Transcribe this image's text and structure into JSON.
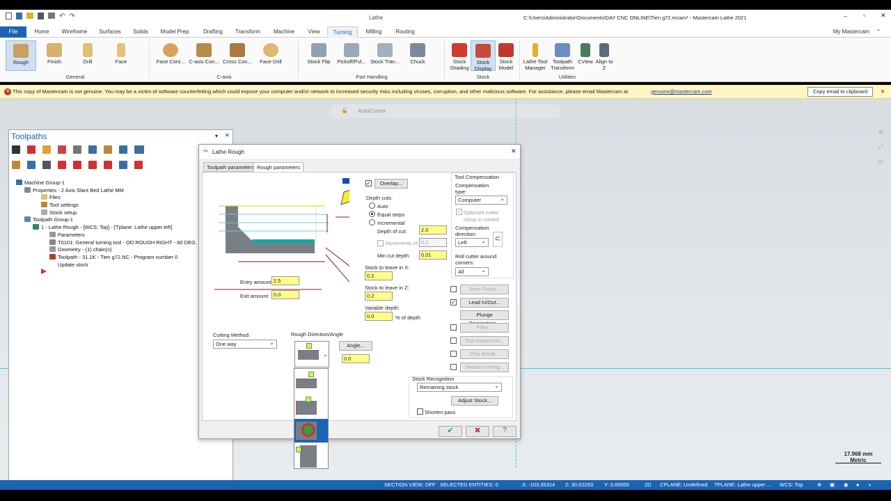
{
  "window": {
    "app_label": "Lathe",
    "title": "C:\\Users\\Administrator\\Documents\\DAY CNC ONLINE\\Tien g72.mcam* - Mastercam Lathe 2021"
  },
  "tabs": [
    "File",
    "Home",
    "Wireframe",
    "Surfaces",
    "Solids",
    "Model Prep",
    "Drafting",
    "Transform",
    "Machine",
    "View",
    "Turning",
    "Milling",
    "Routing"
  ],
  "my_mastercam": "My Mastercam",
  "ribbon": {
    "general": {
      "label": "General",
      "buttons": [
        "Rough",
        "Finish",
        "Drill",
        "Face"
      ]
    },
    "caxis": {
      "label": "C-axis",
      "buttons": [
        "Face Cont...",
        "C-axis Con...",
        "Cross Con...",
        "Face Drill"
      ]
    },
    "part": {
      "label": "Part Handling",
      "buttons": [
        "Stock Flip",
        "Pickoff/Pul...",
        "Stock Tran...",
        "Chuck"
      ]
    },
    "stock": {
      "label": "Stock",
      "buttons": [
        "Stock Shading",
        "Stock Display",
        "Stock Model"
      ]
    },
    "utilities": {
      "label": "Utilities",
      "buttons": [
        "Lathe Tool Manager",
        "Toolpath Transform",
        "CView",
        "Align to Z"
      ]
    }
  },
  "warning": {
    "text": "This copy of Mastercam is not genuine.  You may be a victim of software counterfeiting which could expose your computer and/or network to increased security risks including viruses, corruption, and other malicious software. For assistance, please email Mastercam at",
    "email": "genuine@mastercam.com",
    "copy_button": "Copy email to clipboard"
  },
  "autocursor": "AutoCursor",
  "toolpaths": {
    "title": "Toolpaths",
    "tree": [
      "Machine Group-1",
      "Properties - 2 Axis Slant Bed Lathe MM",
      "Files",
      "Tool settings",
      "Stock setup",
      "Toolpath Group-1",
      "1 - Lathe Rough - [WCS: Top] - [Tplane: Lathe upper left]",
      "Parameters",
      "T0101: General turning tool - OD ROUGH RIGHT - 80 DEG.",
      "Geometry - (1) chain(s)",
      "Toolpath - 31.1K - Tien g72.NC - Program number 0",
      "Update stock"
    ]
  },
  "dialog": {
    "title": "Lathe Rough",
    "tabs": [
      "Toolpath parameters",
      "Rough parameters"
    ],
    "overlap": "Overlap...",
    "depth_cuts": "Depth cuts:",
    "auto": "Auto",
    "equal_steps": "Equal steps",
    "incremental": "Incremental",
    "depth_of_cut_label": "Depth of cut:",
    "depth_of_cut": "2.0",
    "increments_label": "Increments of:",
    "increments": "0.1",
    "min_cut_label": "Min cut depth:",
    "min_cut": "0.01",
    "stock_x_label": "Stock to leave in X:",
    "stock_x": "0.2",
    "stock_z_label": "Stock to leave in Z:",
    "stock_z": "0.2",
    "variable_label": "Variable depth:",
    "variable": "0.0",
    "pct_depth": "% of depth",
    "entry_label": "Entry amount:",
    "entry": "2.5",
    "exit_label": "Exit amount:",
    "exit": "0.0",
    "cutting_method_label": "Cutting Method:",
    "cutting_method": "One way",
    "rough_dir_label": "Rough Direction/Angle",
    "angle_button": "Angle...",
    "angle": "0.0",
    "tool_comp": "Tool Compensation",
    "comp_type_label": "Compensation type:",
    "comp_type": "Computer",
    "optimize": "Optimize cutter comp in control",
    "comp_dir_label": "Compensation direction:",
    "comp_dir": "Left",
    "roll_label": "Roll cutter around corners:",
    "roll": "All",
    "semi_finish": "Semi Finish...",
    "lead": "Lead In/Out...",
    "plunge": "Plunge Parameters...",
    "filter": "Filter...",
    "tool_insp": "Tool Inspection...",
    "chip_break": "Chip Break...",
    "section_turning": "Section turning...",
    "stock_recog": "Stock Recognition",
    "stock_recog_val": "Remaining stock",
    "adjust_stock": "Adjust Stock...",
    "shorten_pass": "Shorten pass"
  },
  "scale": {
    "value": "17.968 mm",
    "unit": "Metric"
  },
  "status": {
    "section_view": "SECTION VIEW: OFF",
    "selected": "SELECTED ENTITIES: 0",
    "x": "X:  -103.35324",
    "z": "Z:  30.02293",
    "y": "Y:  0.00000",
    "mode": "2D",
    "cplane": "CPLANE: Undefined",
    "tplane": "TPLANE: Lathe upper ...",
    "wcs": "WCS: Top"
  },
  "colors": {
    "accent": "#1b64b4",
    "field": "#ffff88",
    "warning": "#fff6c4"
  }
}
